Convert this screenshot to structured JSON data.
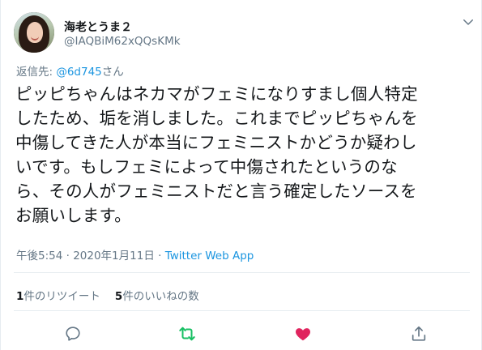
{
  "user": {
    "display_name": "海老とうま２",
    "handle": "@IAQBiM62xQQsKMk"
  },
  "reply": {
    "prefix": "返信先: ",
    "to": "@6d745",
    "suffix": "さん"
  },
  "tweet": {
    "lines": [
      "ピッピちゃんはネカマがフェミになりすまし個人特定",
      "したため、垢を消しました。これまでピッピちゃんを",
      "中傷してきた人が本当にフェミニストかどうか疑わし",
      "いです。もしフェミによって中傷されたというのな",
      "ら、その人がフェミニストだと言う確定したソースを",
      "お願いします。"
    ]
  },
  "meta": {
    "time": "午後5:54",
    "dot": " · ",
    "date": "2020年1月11日",
    "dot2": " · ",
    "client": "Twitter Web App"
  },
  "stats": {
    "retweets_count": "1",
    "retweets_label": "件のリツイート",
    "likes_count": "5",
    "likes_label": "件のいいねの数"
  },
  "icons": {
    "caret": "chevron-down-icon",
    "reply": "comment-icon",
    "retweet": "retweet-icon",
    "like": "heart-icon",
    "share": "share-icon"
  },
  "colors": {
    "link": "#1b95e0",
    "muted": "#657786",
    "retweet_active": "#17bf63",
    "like_active": "#e0245e"
  }
}
